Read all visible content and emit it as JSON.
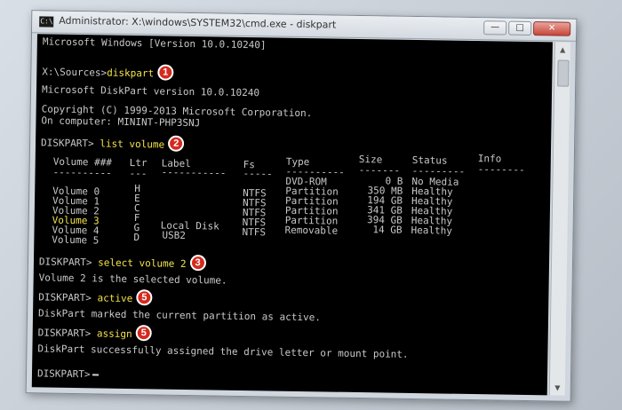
{
  "window": {
    "title": "Administrator: X:\\windows\\SYSTEM32\\cmd.exe - diskpart",
    "icon_label": "C:\\",
    "minimize_icon": "minimize-icon",
    "maximize_icon": "maximize-icon",
    "close_icon": "close-icon"
  },
  "console": {
    "lines": {
      "version": "Microsoft Windows [Version 10.0.10240]",
      "prompt1": "X:\\Sources>",
      "cmd1": "diskpart",
      "dp_version": "Microsoft DiskPart version 10.0.10240",
      "copyright": "Copyright (C) 1999-2013 Microsoft Corporation.",
      "computer": "On computer: MININT-PHP3SNJ",
      "prompt2": "DISKPART>",
      "cmd2": "list volume",
      "prompt3": "DISKPART>",
      "cmd3": "select volume 2",
      "selected_msg": "Volume 2 is the selected volume.",
      "prompt4": "DISKPART>",
      "cmd4": "active",
      "active_msg": "DiskPart marked the current partition as active.",
      "prompt5": "DISKPART>",
      "cmd5": "assign",
      "assign_msg": "DiskPart successfully assigned the drive letter or mount point.",
      "prompt6": "DISKPART>"
    },
    "badges": {
      "b1": "1",
      "b2": "2",
      "b3": "3",
      "b4": "5",
      "b5": "5"
    },
    "volume_table": {
      "headers": {
        "volume": "Volume ###",
        "ltr": "Ltr",
        "label": "Label",
        "fs": "Fs",
        "type": "Type",
        "size": "Size",
        "status": "Status",
        "info": "Info"
      },
      "separators": {
        "volume": "----------",
        "ltr": "---",
        "label": "-----------",
        "fs": "-----",
        "type": "----------",
        "size": "-------",
        "status": "---------",
        "info": "--------"
      },
      "rows": [
        {
          "volume": "",
          "ltr": "",
          "label": "",
          "fs": "",
          "type": "DVD-ROM",
          "size": "0 B",
          "status": "No Media"
        },
        {
          "volume": "Volume 0",
          "ltr": "H",
          "label": "",
          "fs": "NTFS",
          "type": "Partition",
          "size": "350 MB",
          "status": "Healthy"
        },
        {
          "volume": "Volume 1",
          "ltr": "E",
          "label": "",
          "fs": "NTFS",
          "type": "Partition",
          "size": "194 GB",
          "status": "Healthy"
        },
        {
          "volume": "Volume 2",
          "ltr": "C",
          "label": "",
          "fs": "NTFS",
          "type": "Partition",
          "size": "341 GB",
          "status": "Healthy"
        },
        {
          "volume": "Volume 3",
          "ltr": "F",
          "label": "",
          "fs": "NTFS",
          "type": "Partition",
          "size": "394 GB",
          "status": "Healthy"
        },
        {
          "volume": "Volume 4",
          "ltr": "G",
          "label": "Local Disk",
          "fs": "NTFS",
          "type": "Removable",
          "size": "14 GB",
          "status": "Healthy"
        },
        {
          "volume": "Volume 5",
          "ltr": "D",
          "label": "USB2",
          "fs": "",
          "type": "",
          "size": "",
          "status": ""
        }
      ]
    }
  },
  "colors": {
    "console_bg": "#000000",
    "console_text": "#c8c8c8",
    "command_highlight": "#f2e24a",
    "badge_red": "#d42a1e"
  }
}
